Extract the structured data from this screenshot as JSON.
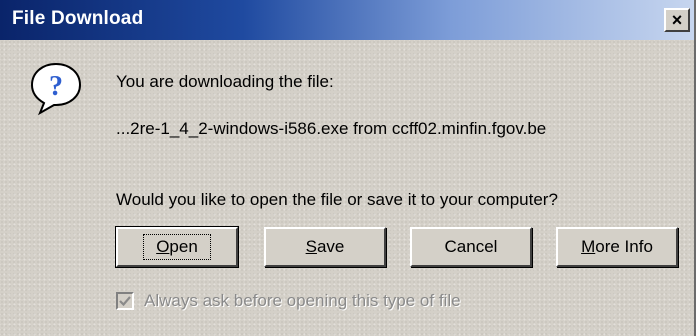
{
  "window": {
    "title": "File Download",
    "close_glyph": "×"
  },
  "message": {
    "line1": "You are downloading the file:",
    "filename": "...2re-1_4_2-windows-i586.exe from ccff02.minfin.fgov.be",
    "question": "Would you like to open the file or save it to your computer?"
  },
  "buttons": [
    {
      "accel": "O",
      "rest": "pen",
      "label": "Open",
      "default": true
    },
    {
      "accel": "S",
      "rest": "ave",
      "label": "Save"
    },
    {
      "accel": "",
      "rest": "Cancel",
      "label": "Cancel"
    },
    {
      "accel": "M",
      "rest": "ore Info",
      "label": "More Info"
    }
  ],
  "checkbox": {
    "label": "Always ask before opening this type of file",
    "checked": true,
    "disabled": true
  },
  "icons": {
    "question": "question-icon",
    "check": "checkmark-icon",
    "close": "close-icon"
  },
  "colors": {
    "title_start": "#0a246a",
    "title_end": "#c7d6ef",
    "face": "#d4d0c8",
    "icon_blue": "#2f5fd0"
  }
}
